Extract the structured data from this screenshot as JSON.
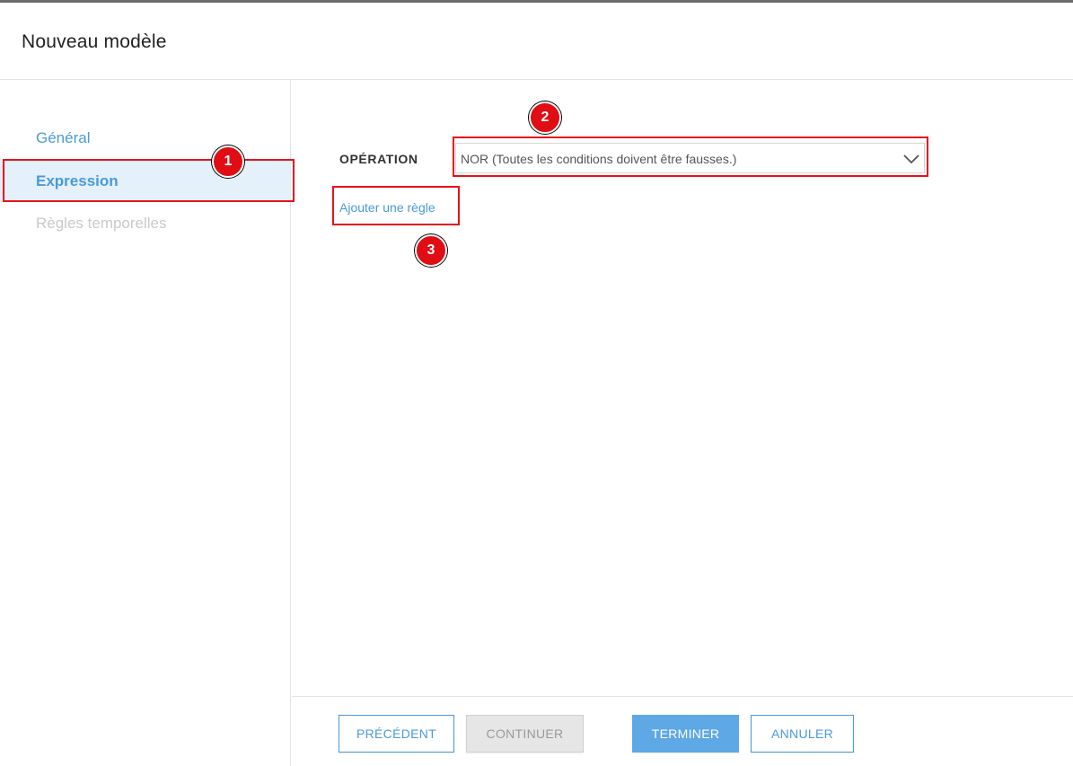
{
  "dialog": {
    "title": "Nouveau modèle"
  },
  "sidebar": {
    "items": [
      {
        "label": "Général",
        "state": "link"
      },
      {
        "label": "Expression",
        "state": "active"
      },
      {
        "label": "Règles temporelles",
        "state": "disabled"
      }
    ]
  },
  "main": {
    "operation_label": "OPÉRATION",
    "operation_value": "NOR (Toutes les conditions doivent être fausses.)",
    "add_rule_link": "Ajouter une règle"
  },
  "footer": {
    "prev_label": "PRÉCÉDENT",
    "continue_label": "CONTINUER",
    "finish_label": "TERMINER",
    "cancel_label": "ANNULER"
  },
  "annotations": [
    {
      "number": "1",
      "target": "sidebar-item-expression"
    },
    {
      "number": "2",
      "target": "operation-select"
    },
    {
      "number": "3",
      "target": "add-rule-link"
    }
  ],
  "colors": {
    "accent": "#4a9ad8",
    "active_bg": "#e4f0fa",
    "primary_button": "#5ea8e6",
    "annotation_red": "#e00d14"
  },
  "icons": {
    "select_arrow": "chevron-down-icon"
  }
}
